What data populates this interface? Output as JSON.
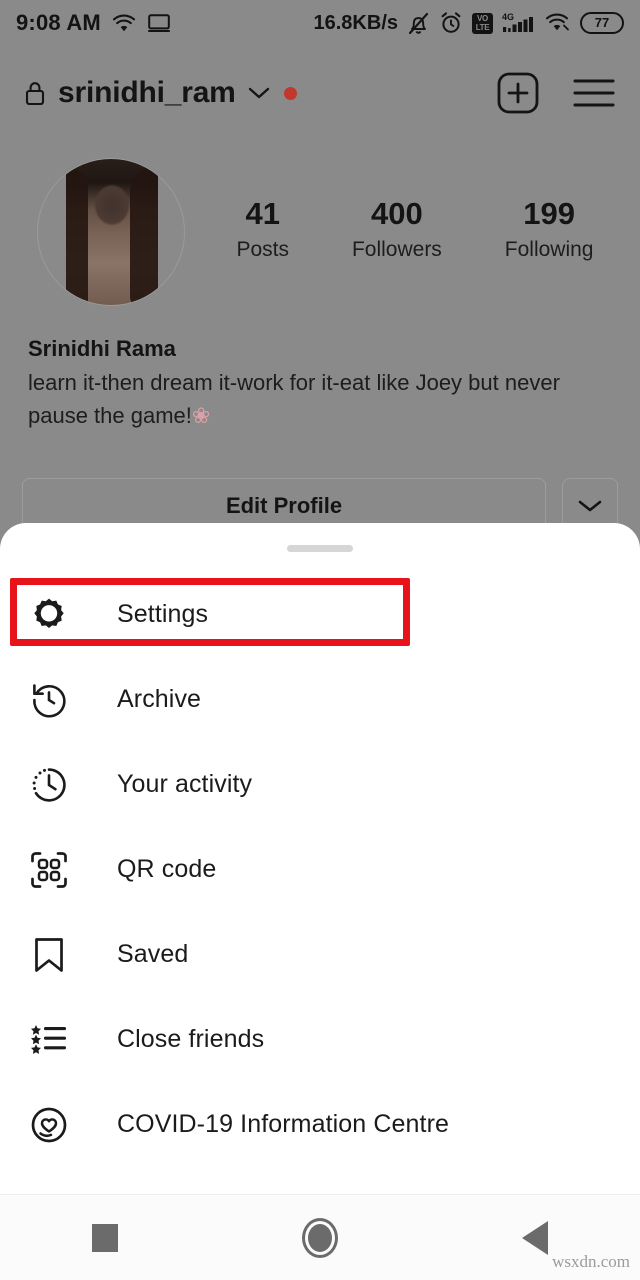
{
  "status_bar": {
    "time": "9:08 AM",
    "left_icons": [
      "wifi-icon",
      "cast-screen-icon"
    ],
    "network_speed": "16.8KB/s",
    "right_icons": [
      "bell-muted-icon",
      "alarm-clock-icon",
      "volte-icon",
      "signal-4g-icon",
      "wifi-icon"
    ],
    "volte_top": "VO",
    "volte_bottom": "LTE",
    "signal_label": "4G",
    "battery_percent": "77"
  },
  "app_bar": {
    "lock_icon": "lock-icon",
    "username": "srinidhi_ram",
    "dropdown_icon": "chevron-down-icon",
    "unread_dot": true,
    "create_icon": "plus-box-icon",
    "menu_icon": "hamburger-menu-icon"
  },
  "profile": {
    "avatar_alt": "profile-photo",
    "stats": [
      {
        "value": "41",
        "label": "Posts"
      },
      {
        "value": "400",
        "label": "Followers"
      },
      {
        "value": "199",
        "label": "Following"
      }
    ],
    "display_name": "Srinidhi Rama",
    "bio_line_1": "learn it-then dream it-work for it-eat like Joey but",
    "bio_line_2": "never pause the game!",
    "bio_emoji": "❀",
    "edit_profile_label": "Edit Profile",
    "expand_icon": "chevron-down-icon"
  },
  "sheet": {
    "handle": "drag-handle",
    "items": [
      {
        "label": "Settings",
        "icon": "gear-icon",
        "highlighted": true
      },
      {
        "label": "Archive",
        "icon": "clock-rewind-icon",
        "highlighted": false
      },
      {
        "label": "Your activity",
        "icon": "activity-clock-icon",
        "highlighted": false
      },
      {
        "label": "QR code",
        "icon": "qr-code-icon",
        "highlighted": false
      },
      {
        "label": "Saved",
        "icon": "bookmark-icon",
        "highlighted": false
      },
      {
        "label": "Close friends",
        "icon": "star-list-icon",
        "highlighted": false
      },
      {
        "label": "COVID-19 Information Centre",
        "icon": "heart-circle-icon",
        "highlighted": false
      }
    ],
    "highlight_color": "#e8121a"
  },
  "nav_bar": {
    "recents": "recents-square-icon",
    "home": "home-circle-icon",
    "back": "back-triangle-icon"
  },
  "watermark": "wsxdn.com"
}
